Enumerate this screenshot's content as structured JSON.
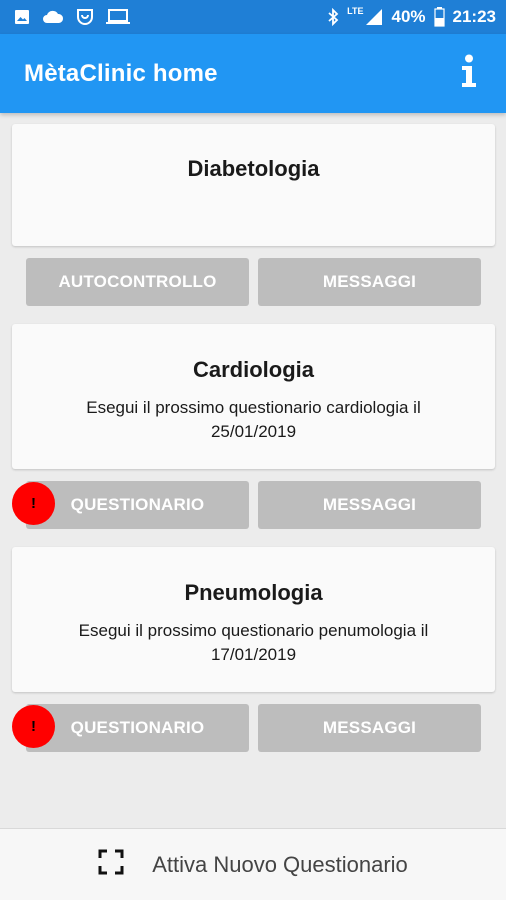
{
  "status_bar": {
    "left_icons": [
      "image-icon",
      "cloud-icon",
      "shield-notification-icon",
      "laptop-icon"
    ],
    "lte": "LTE",
    "battery": "40%",
    "time": "21:23"
  },
  "header": {
    "title": "MètaClinic home",
    "info_icon": "info-icon"
  },
  "cards": [
    {
      "title": "Diabetologia",
      "text": "",
      "left_button": "AUTOCONTROLLO",
      "right_button": "MESSAGGI",
      "alert": false
    },
    {
      "title": "Cardiologia",
      "text": "Esegui il prossimo questionario cardiologia il 25/01/2019",
      "left_button": "QUESTIONARIO",
      "right_button": "MESSAGGI",
      "alert": true,
      "alert_symbol": "!"
    },
    {
      "title": "Pneumologia",
      "text": "Esegui il prossimo questionario penumologia il 17/01/2019",
      "left_button": "QUESTIONARIO",
      "right_button": "MESSAGGI",
      "alert": true,
      "alert_symbol": "!"
    }
  ],
  "bottom_bar": {
    "icon": "scan-frame-icon",
    "label": "Attiva Nuovo Questionario"
  },
  "colors": {
    "app_bar": "#2196f3",
    "status_bar": "#1f7fd6",
    "button": "#bdbdbd",
    "alert_badge": "#ff0000"
  }
}
